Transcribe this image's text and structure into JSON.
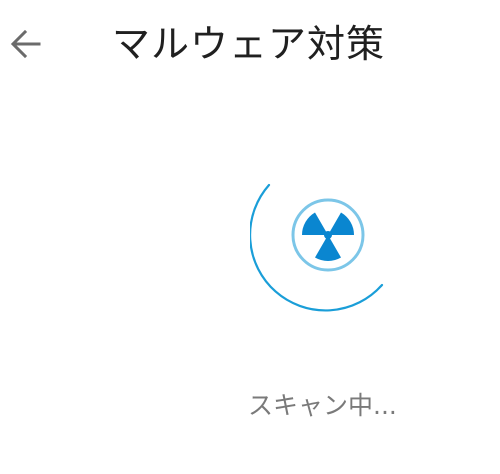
{
  "app": {
    "title": "マルウェア対策"
  },
  "header": {
    "back_icon": "arrow-left-icon"
  },
  "scan": {
    "icon": "radiation-icon",
    "status": "スキャン中..."
  },
  "colors": {
    "accent": "#1a9ed8",
    "icon_fill": "#0a86d0",
    "icon_ring": "#7cc6e8",
    "title_text": "#202020",
    "status_text": "#7a7a7a",
    "back_icon": "#6b6b6b"
  }
}
